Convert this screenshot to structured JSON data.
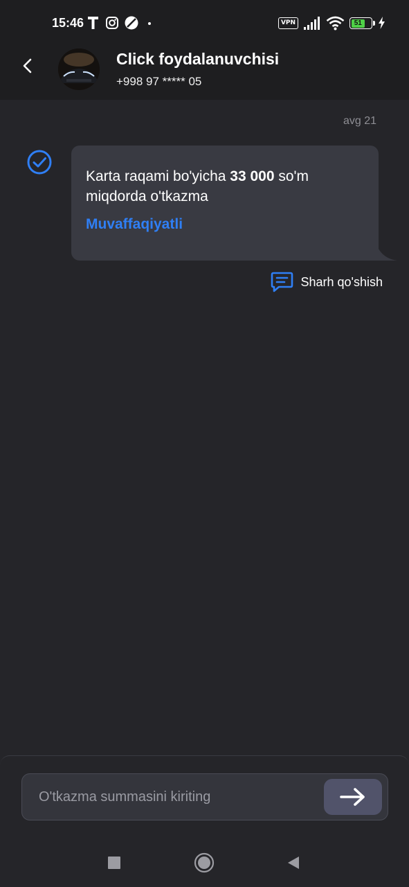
{
  "status_bar": {
    "time": "15:46",
    "left_icons": [
      "t-app-icon",
      "instagram-icon",
      "no-disturb-icon",
      "dot-icon"
    ],
    "vpn_label": "VPN",
    "battery_level": "51",
    "right_icons": [
      "signal-icon",
      "wifi-icon",
      "battery-icon",
      "charging-icon"
    ]
  },
  "header": {
    "title": "Click foydalanuvchisi",
    "phone": "+998 97 ***** 05",
    "back_icon": "chevron-left-icon"
  },
  "chat": {
    "date": "avg 21",
    "message": {
      "text_before": "Karta raqami bo'yicha ",
      "amount": "33 000",
      "text_after": " so'm miqdorda o'tkazma",
      "status": "Muvaffaqiyatli",
      "status_color": "#2f7ff5",
      "status_icon": "check-circle-icon"
    },
    "comment_label": "Sharh qo'shish",
    "comment_icon": "message-icon"
  },
  "composer": {
    "placeholder": "O'tkazma summasini kiriting",
    "value": "",
    "send_icon": "arrow-right-icon"
  },
  "nav_bar": {
    "icons": [
      "recents-square-icon",
      "home-circle-icon",
      "back-triangle-icon"
    ]
  },
  "colors": {
    "background": "#252529",
    "header": "#1e1e20",
    "bubble": "#393a42",
    "accent": "#2f7ff5"
  }
}
